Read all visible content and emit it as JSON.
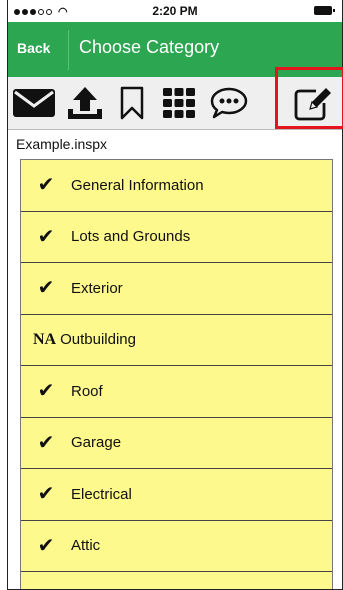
{
  "status_bar": {
    "time": "2:20 PM"
  },
  "nav": {
    "back_label": "Back",
    "title": "Choose Category"
  },
  "toolbar": {
    "icons": [
      "envelope-icon",
      "upload-icon",
      "bookmark-icon",
      "grid-icon",
      "speech-bubble-icon",
      "edit-icon"
    ]
  },
  "file": {
    "name": "Example.inspx"
  },
  "categories": [
    {
      "label": "General Information",
      "status": "done"
    },
    {
      "label": "Lots and Grounds",
      "status": "done"
    },
    {
      "label": "Exterior",
      "status": "done"
    },
    {
      "label": "Outbuilding",
      "status": "NA"
    },
    {
      "label": "Roof",
      "status": "done"
    },
    {
      "label": "Garage",
      "status": "done"
    },
    {
      "label": "Electrical",
      "status": "done"
    },
    {
      "label": "Attic",
      "status": "done"
    }
  ],
  "colors": {
    "nav_green": "#2da651",
    "row_yellow": "#fdf98d",
    "highlight_red": "#e3141e"
  }
}
